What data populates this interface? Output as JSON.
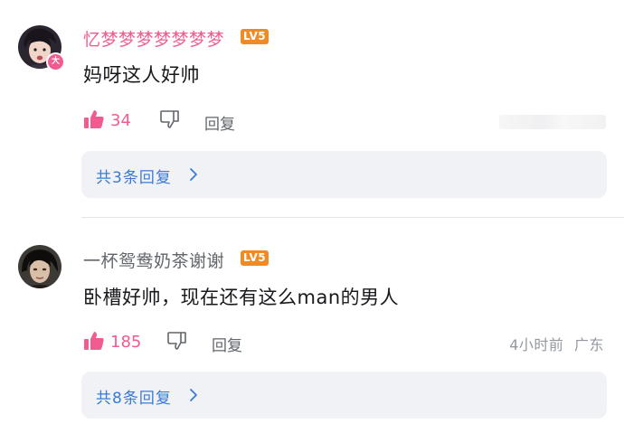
{
  "comments": [
    {
      "username": "忆梦梦梦梦梦梦梦",
      "username_color": "#f25b8f",
      "level": "LV5",
      "vip_badge": "大",
      "content": "妈呀这人好帅",
      "likes": "34",
      "reply_label": "回复",
      "time": "",
      "location": "",
      "replies_label": "共3条回复"
    },
    {
      "username": "一杯鸳鸯奶茶谢谢",
      "username_color": "#61666d",
      "level": "LV5",
      "content": "卧槽好帅，现在还有这么man的男人",
      "likes": "185",
      "reply_label": "回复",
      "time": "4小时前",
      "location": "广东",
      "replies_label": "共8条回复"
    }
  ],
  "colors": {
    "accent_pink": "#f25b8f",
    "link_blue": "#3a7bd5",
    "level_orange": "#f08a24"
  },
  "icons": [
    "like-icon",
    "dislike-icon",
    "chevron-right-icon"
  ]
}
